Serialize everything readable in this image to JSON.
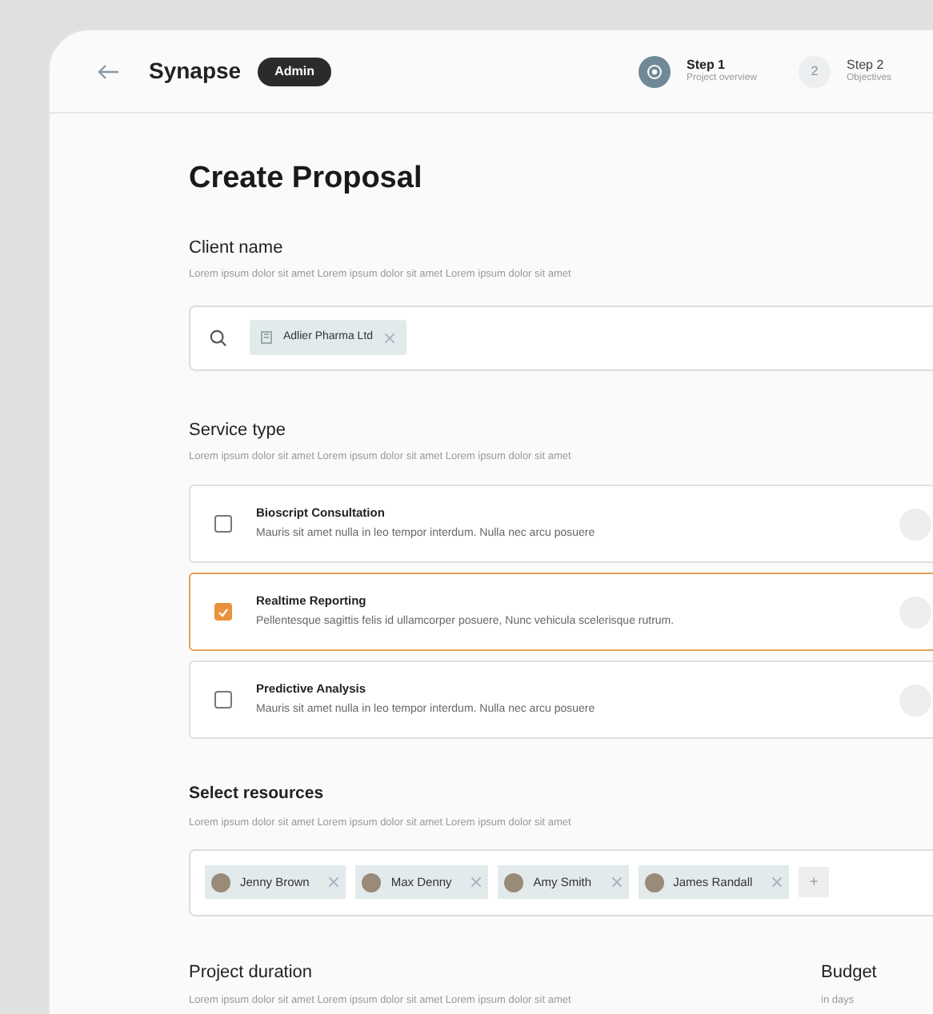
{
  "header": {
    "brand": "Synapse",
    "badge": "Admin",
    "steps": [
      {
        "title": "Step 1",
        "subtitle": "Project overview",
        "active": true
      },
      {
        "number": "2",
        "title": "Step 2",
        "subtitle": "Objectives",
        "active": false
      }
    ]
  },
  "title": "Create Proposal",
  "client": {
    "label": "Client name",
    "description": "Lorem ipsum dolor sit amet Lorem ipsum dolor sit amet Lorem ipsum dolor sit amet",
    "tag": "Adlier Pharma Ltd"
  },
  "service": {
    "label": "Service type",
    "description": "Lorem ipsum dolor sit amet Lorem ipsum dolor sit amet Lorem ipsum dolor sit amet",
    "options": [
      {
        "title": "Bioscript Consultation",
        "text": "Mauris sit amet nulla in leo tempor interdum. Nulla nec arcu posuere",
        "checked": false
      },
      {
        "title": "Realtime Reporting",
        "text": "Pellentesque sagittis felis id ullamcorper posuere, Nunc vehicula scelerisque rutrum.",
        "checked": true
      },
      {
        "title": "Predictive Analysis",
        "text": "Mauris sit amet nulla in leo tempor interdum. Nulla nec arcu posuere",
        "checked": false
      }
    ]
  },
  "resources": {
    "label": "Select resources",
    "description": "Lorem ipsum dolor sit amet Lorem ipsum dolor sit amet Lorem ipsum dolor sit amet",
    "people": [
      "Jenny Brown",
      "Max Denny",
      "Amy Smith",
      "James Randall"
    ],
    "add": "+"
  },
  "duration": {
    "label": "Project duration",
    "description": "Lorem ipsum dolor sit amet Lorem ipsum dolor sit amet Lorem ipsum dolor sit amet"
  },
  "budget": {
    "label": "Budget",
    "description": "in days"
  }
}
